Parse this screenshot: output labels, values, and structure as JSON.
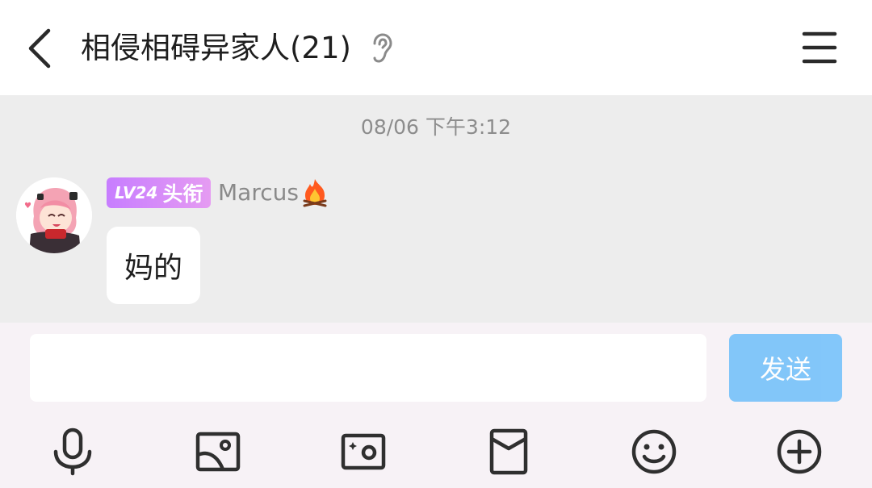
{
  "header": {
    "title": "相侵相碍异家人(21)",
    "back_icon": "chevron-left-icon",
    "ear_icon": "ear-icon",
    "menu_icon": "hamburger-menu-icon"
  },
  "chat": {
    "timestamp": "08/06 下午3:12",
    "messages": [
      {
        "level_badge": "LV24",
        "title_badge": "头衔",
        "sender": "Marcus",
        "sender_emoji": "fire-icon",
        "text": "妈的"
      }
    ]
  },
  "composer": {
    "input_value": "",
    "input_placeholder": "",
    "send_label": "发送",
    "send_color": "#7cc4fa"
  },
  "toolbar": {
    "items": [
      {
        "icon": "microphone-icon"
      },
      {
        "icon": "image-icon"
      },
      {
        "icon": "camera-icon"
      },
      {
        "icon": "red-packet-icon"
      },
      {
        "icon": "emoji-icon"
      },
      {
        "icon": "plus-circle-icon"
      }
    ]
  },
  "colors": {
    "badge_start": "#c77dff",
    "badge_end": "#e59bf2",
    "chat_background": "#ededed",
    "composer_background": "#f7f2f6"
  }
}
